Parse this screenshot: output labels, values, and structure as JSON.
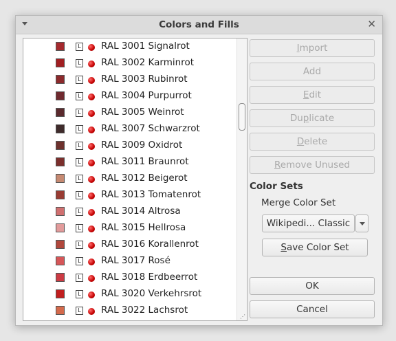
{
  "window": {
    "title": "Colors and Fills"
  },
  "colors": [
    {
      "name": "RAL 3001 Signalrot",
      "swatch": "#a52a2e",
      "icon": "L"
    },
    {
      "name": "RAL 3002 Karminrot",
      "swatch": "#a11f22",
      "icon": "L"
    },
    {
      "name": "RAL 3003 Rubinrot",
      "swatch": "#8c2a2c",
      "icon": "L"
    },
    {
      "name": "RAL 3004 Purpurrot",
      "swatch": "#6f2a2f",
      "icon": "L"
    },
    {
      "name": "RAL 3005 Weinrot",
      "swatch": "#5a2a2d",
      "icon": "L"
    },
    {
      "name": "RAL 3007 Schwarzrot",
      "swatch": "#3f2b2b",
      "icon": "L"
    },
    {
      "name": "RAL 3009 Oxidrot",
      "swatch": "#6d312d",
      "icon": "L"
    },
    {
      "name": "RAL 3011 Braunrot",
      "swatch": "#7b2f2c",
      "icon": "L"
    },
    {
      "name": "RAL 3012 Beigerot",
      "swatch": "#c68a72",
      "icon": "L"
    },
    {
      "name": "RAL 3013 Tomatenrot",
      "swatch": "#993c33",
      "icon": "L"
    },
    {
      "name": "RAL 3014 Altrosa",
      "swatch": "#d07070",
      "icon": "L"
    },
    {
      "name": "RAL 3015 Hellrosa",
      "swatch": "#e29b9b",
      "icon": "L"
    },
    {
      "name": "RAL 3016 Korallenrot",
      "swatch": "#b0473c",
      "icon": "L"
    },
    {
      "name": "RAL 3017 Rosé",
      "swatch": "#d65658",
      "icon": "L"
    },
    {
      "name": "RAL 3018 Erdbeerrot",
      "swatch": "#cc3b44",
      "icon": "L"
    },
    {
      "name": "RAL 3020 Verkehrsrot",
      "swatch": "#c11f1f",
      "icon": "L"
    },
    {
      "name": "RAL 3022 Lachsrot",
      "swatch": "#d46a4c",
      "icon": "L"
    }
  ],
  "buttons": {
    "import": {
      "pre": "",
      "ul": "I",
      "post": "mport"
    },
    "add": "Add",
    "edit": {
      "pre": "",
      "ul": "E",
      "post": "dit"
    },
    "duplicate": {
      "pre": "Du",
      "ul": "p",
      "post": "licate"
    },
    "delete": {
      "pre": "",
      "ul": "D",
      "post": "elete"
    },
    "remove_unused": {
      "pre": "",
      "ul": "R",
      "post": "emove Unused"
    },
    "save_color_set": {
      "pre": "",
      "ul": "S",
      "post": "ave Color Set"
    },
    "ok": "OK",
    "cancel": "Cancel"
  },
  "color_sets": {
    "heading": "Color Sets",
    "merge_label": "Merge Color Set",
    "selected": "Wikipedi... Classic"
  }
}
